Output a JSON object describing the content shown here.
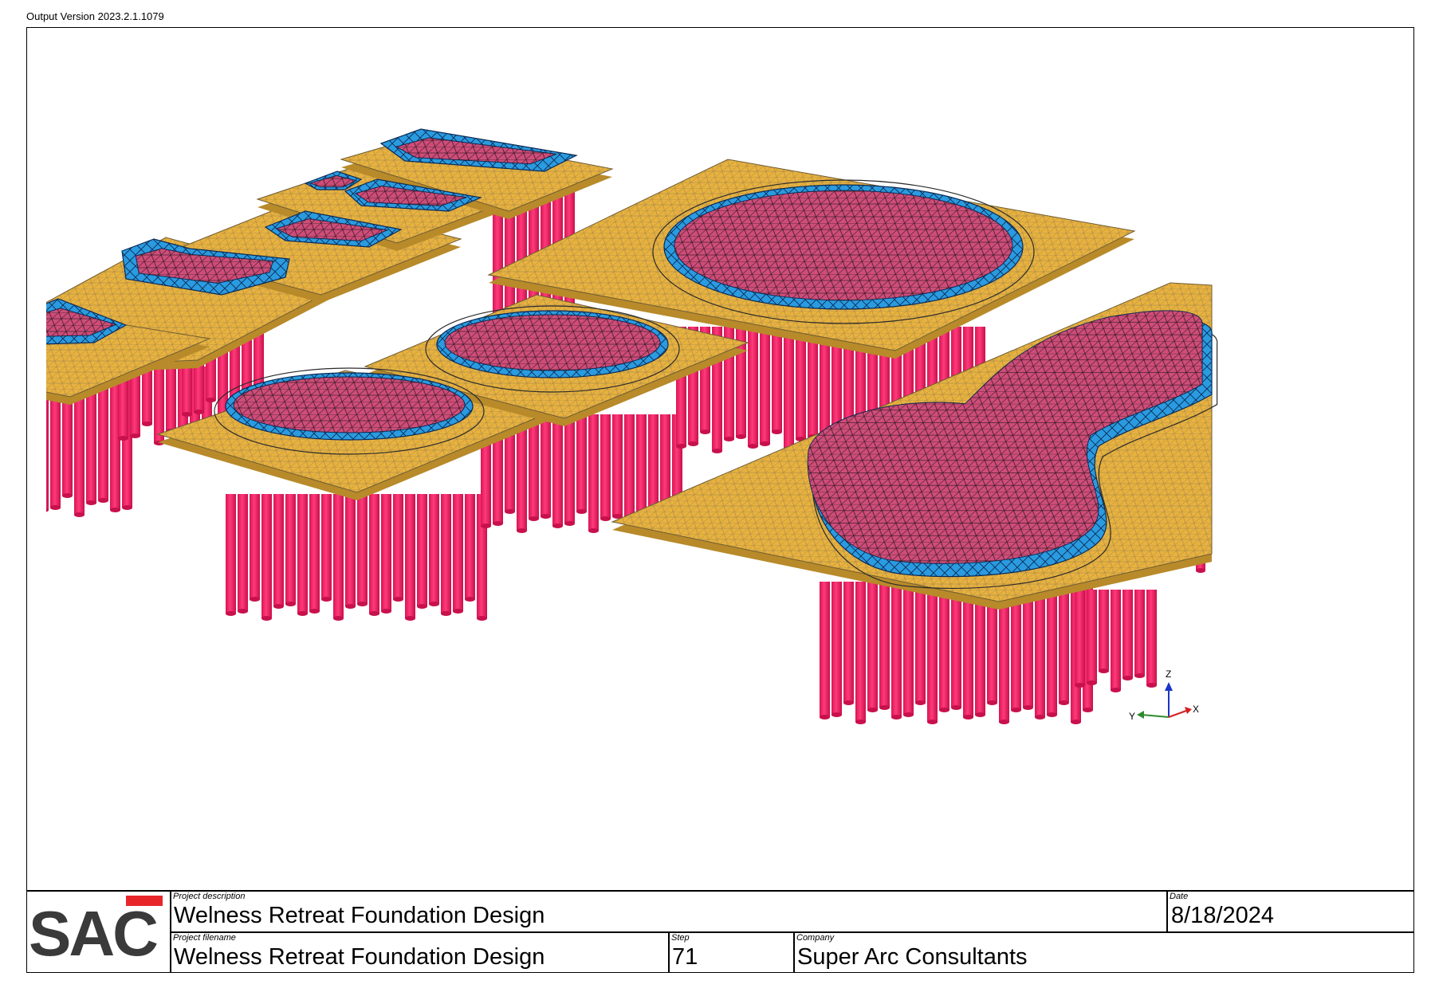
{
  "header": {
    "version": "Output Version 2023.2.1.1079"
  },
  "model": {
    "colors": {
      "slab": "#e8b23e",
      "pile": "#ff2467",
      "pool_floor": "#cf4d79",
      "pool_wall": "#2a9be0",
      "mesh_line": "#6b6b6b"
    }
  },
  "axes": {
    "z": "Z",
    "y": "Y",
    "x": "X",
    "colors": {
      "z": "#1a35c8",
      "y": "#2e8b2e",
      "x": "#d41f1f"
    }
  },
  "titleblock": {
    "logo": "SAC",
    "project_description_label": "Project description",
    "project_description": "Welness Retreat Foundation Design",
    "date_label": "Date",
    "date": "8/18/2024",
    "project_filename_label": "Project filename",
    "project_filename": "Welness Retreat Foundation Design",
    "step_label": "Step",
    "step": "71",
    "company_label": "Company",
    "company": "Super Arc Consultants"
  }
}
